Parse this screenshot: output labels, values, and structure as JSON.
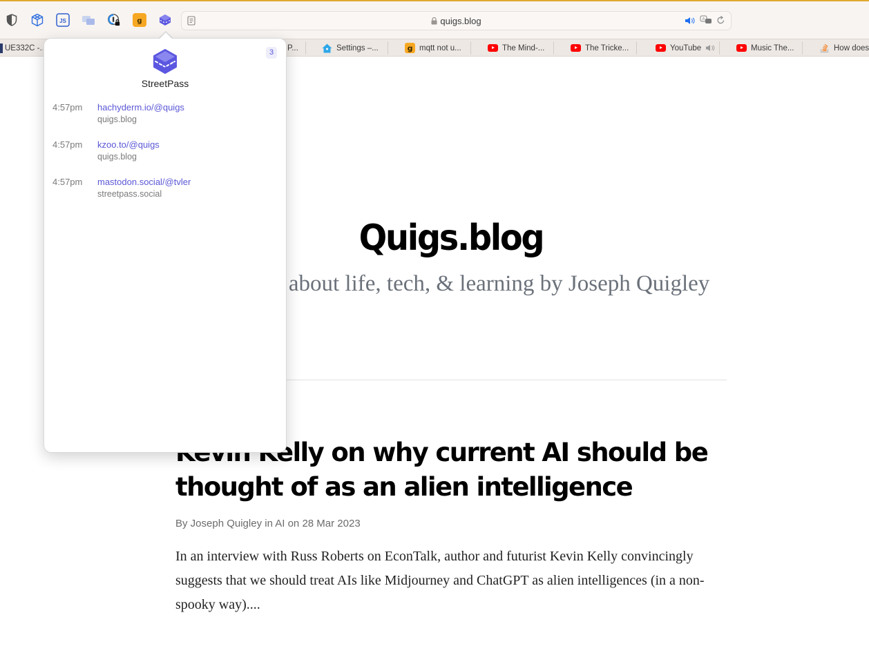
{
  "browser": {
    "extensions": [
      {
        "name": "privacy-shield"
      },
      {
        "name": "cube-outline"
      },
      {
        "name": "javascript-toggle"
      },
      {
        "name": "picture-in-picture"
      },
      {
        "name": "password-manager-locked"
      },
      {
        "name": "g-extension"
      },
      {
        "name": "streetpass"
      }
    ],
    "url": "quigs.blog",
    "tabs": [
      {
        "label": "UE332C -...",
        "icon": "monitor-icon"
      },
      {
        "label": "P...",
        "icon": "none"
      },
      {
        "label": "Settings –...",
        "icon": "home-assistant-icon"
      },
      {
        "label": "mqtt not u...",
        "icon": "g-icon"
      },
      {
        "label": "The Mind-...",
        "icon": "youtube-icon"
      },
      {
        "label": "The Tricke...",
        "icon": "youtube-icon"
      },
      {
        "label": "YouTube",
        "icon": "youtube-icon",
        "audio": true
      },
      {
        "label": "Music The...",
        "icon": "youtube-icon"
      },
      {
        "label": "How does",
        "icon": "stackoverflow-icon"
      }
    ]
  },
  "popover": {
    "app_name": "StreetPass",
    "count": "3",
    "entries": [
      {
        "time": "4:57pm",
        "link": "hachyderm.io/@quigs",
        "source": "quigs.blog"
      },
      {
        "time": "4:57pm",
        "link": "kzoo.to/@quigs",
        "source": "quigs.blog"
      },
      {
        "time": "4:57pm",
        "link": "mastodon.social/@tvler",
        "source": "streetpass.social"
      }
    ],
    "accent": "#5b57d6"
  },
  "page": {
    "site_title": "Quigs.blog",
    "tagline_visible": "ional blog about life, tech, & learning by Joseph Quigley",
    "post": {
      "title": "Kevin Kelly on why current AI should be thought of as an alien intelligence",
      "meta": "By Joseph Quigley in AI on 28 Mar 2023",
      "excerpt": "In an interview with Russ Roberts on EconTalk, author and futurist Kevin Kelly convincingly suggests that we should treat AIs like Midjourney and ChatGPT as alien intelligences (in a non-spooky way)...."
    }
  }
}
